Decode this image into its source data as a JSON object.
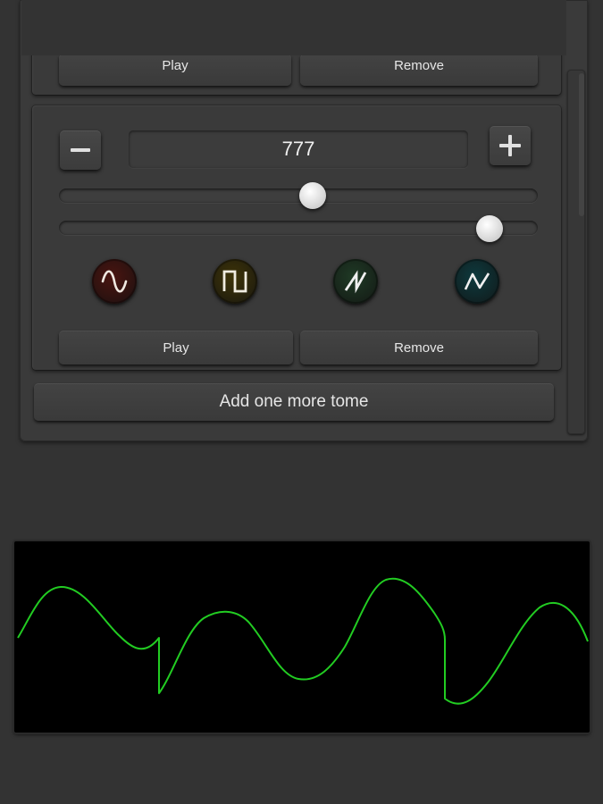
{
  "previous_tone": {
    "play_label": "Play",
    "remove_label": "Remove"
  },
  "tone": {
    "frequency_value": "777",
    "frequency_slider": {
      "value": 0.53
    },
    "volume_slider": {
      "value": 0.9
    },
    "waveforms": [
      {
        "icon": "sine-wave-icon",
        "color": "#4a1410",
        "stroke": "#f0e8e0"
      },
      {
        "icon": "square-wave-icon",
        "color": "#3e3408",
        "stroke": "#f0ece0"
      },
      {
        "icon": "sawtooth-wave-icon",
        "color": "#1f3a25",
        "stroke": "#f0f0f0"
      },
      {
        "icon": "triangle-wave-icon",
        "color": "#0e3a3e",
        "stroke": "#f0f0f0"
      }
    ],
    "play_label": "Play",
    "remove_label": "Remove"
  },
  "add_tone_label": "Add one more tome",
  "oscilloscope": {
    "trace_color": "#22cc22",
    "background": "#000000"
  }
}
